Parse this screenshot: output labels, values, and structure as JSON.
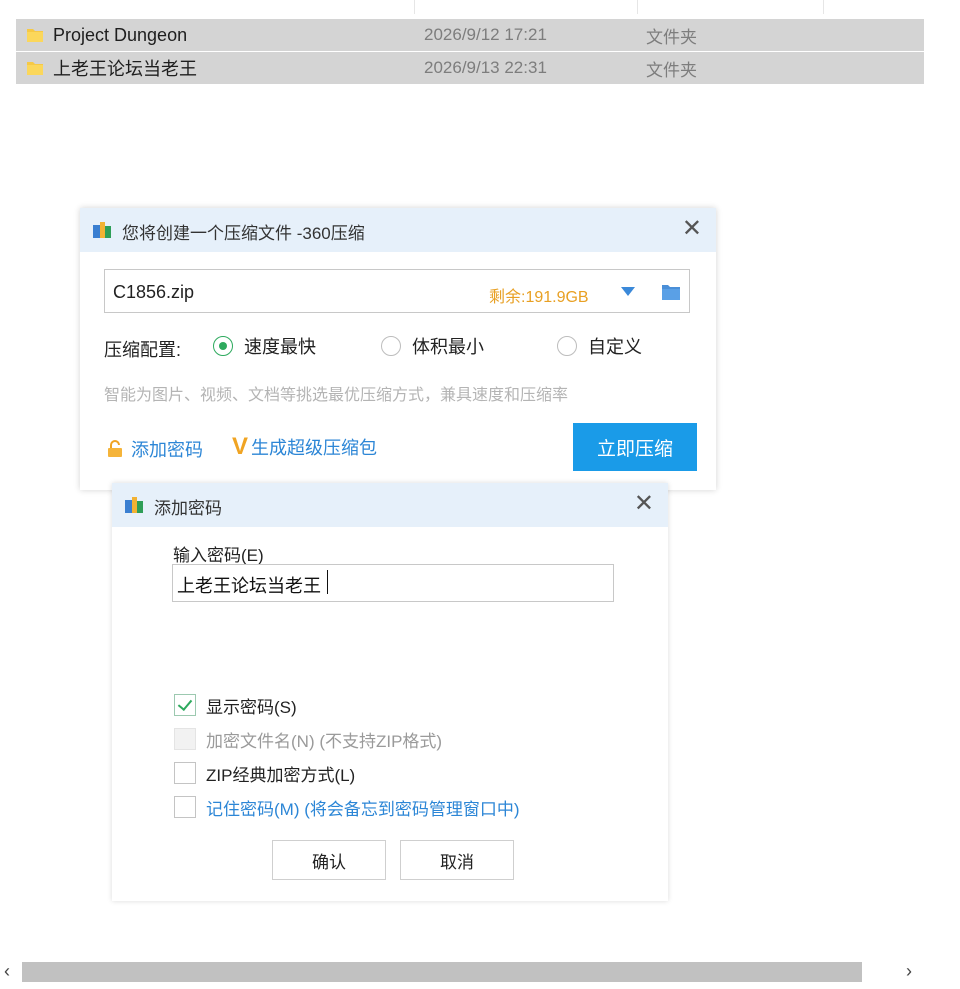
{
  "files": [
    {
      "name": "Project Dungeon",
      "date": "2026/9/12 17:21",
      "type": "文件夹"
    },
    {
      "name": "上老王论坛当老王",
      "date": "2026/9/13 22:31",
      "type": "文件夹"
    }
  ],
  "compress_dialog": {
    "title": "您将创建一个压缩文件 -360压缩",
    "filename": "C1856.zip",
    "free_space": "剩余:191.9GB",
    "config_label": "压缩配置:",
    "options": [
      "速度最快",
      "体积最小",
      "自定义"
    ],
    "selected_option": "速度最快",
    "hint": "智能为图片、视频、文档等挑选最优压缩方式，兼具速度和压缩率",
    "add_password_link": "添加密码",
    "super_package_link": "生成超级压缩包",
    "compress_button": "立即压缩"
  },
  "password_dialog": {
    "title": "添加密码",
    "input_label": "输入密码(E)",
    "password_value": "上老王论坛当老王",
    "checkboxes": [
      {
        "label": "显示密码(S)",
        "checked": true,
        "disabled": false
      },
      {
        "label": "加密文件名(N) (不支持ZIP格式)",
        "checked": false,
        "disabled": true
      },
      {
        "label": "ZIP经典加密方式(L)",
        "checked": false,
        "disabled": false
      },
      {
        "label": "记住密码(M) (将会备忘到密码管理窗口中)",
        "checked": false,
        "disabled": false
      }
    ],
    "ok_button": "确认",
    "cancel_button": "取消"
  },
  "scrollbar": {
    "left_arrow": "‹",
    "right_arrow": "›"
  },
  "colors": {
    "accent": "#1a9be8",
    "link": "#2c86d6",
    "radio_on": "#2eaa5e",
    "free_space": "#e8a023",
    "title_bar": "#e6f0fa"
  }
}
